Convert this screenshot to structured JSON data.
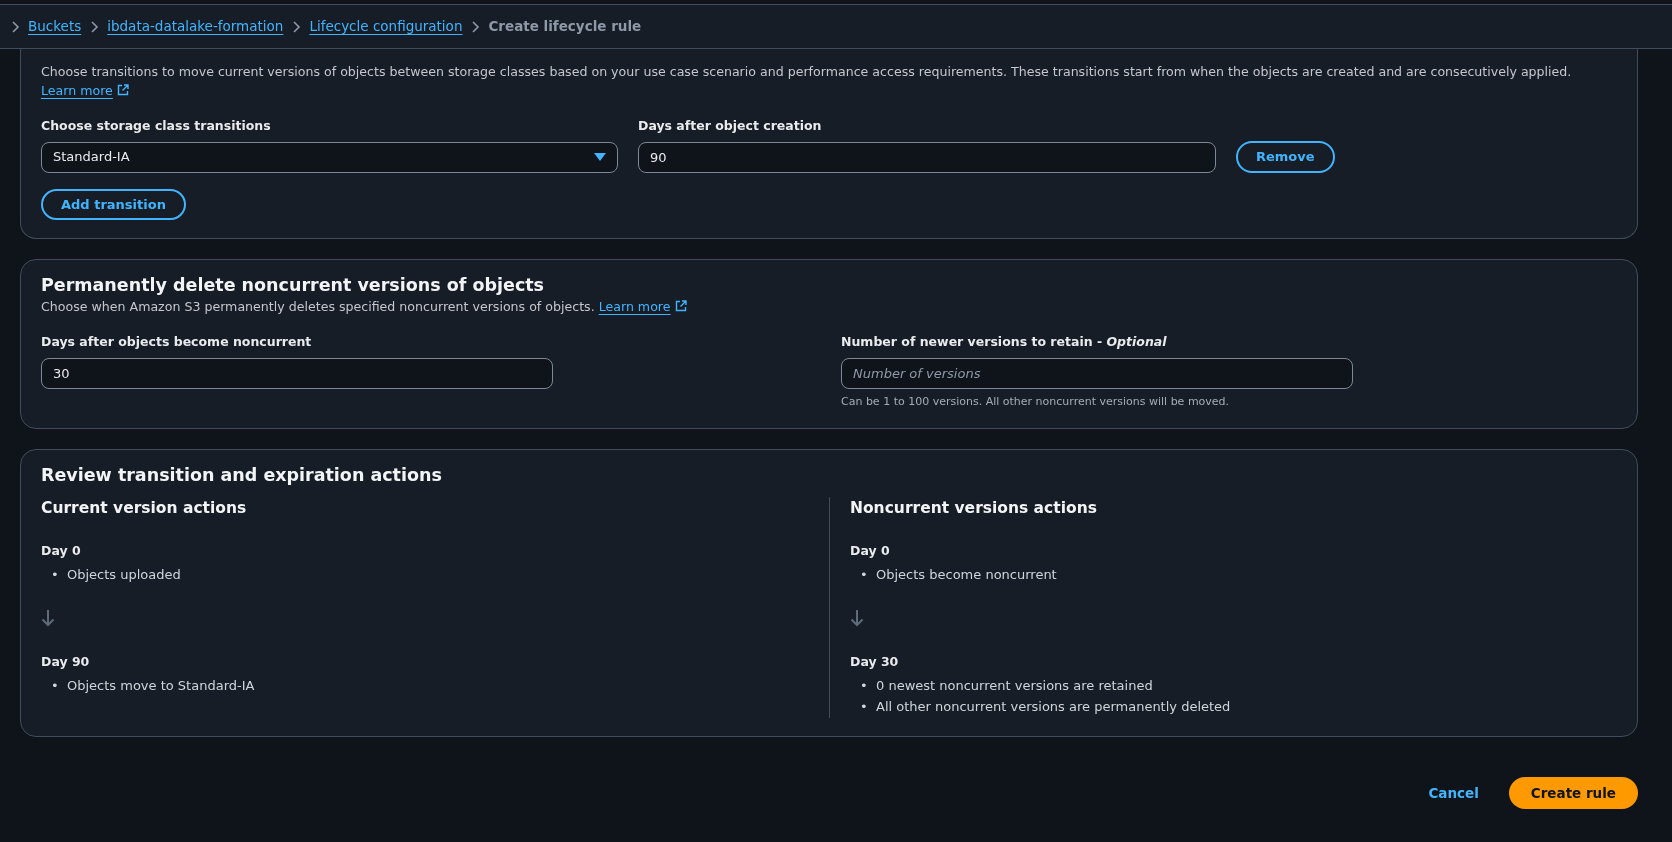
{
  "breadcrumbs": [
    {
      "label": "Buckets",
      "link": true
    },
    {
      "label": "ibdata-datalake-formation",
      "link": true
    },
    {
      "label": "Lifecycle configuration",
      "link": true
    },
    {
      "label": "Create lifecycle rule",
      "link": false
    }
  ],
  "transitions": {
    "description": "Choose transitions to move current versions of objects between storage classes based on your use case scenario and performance access requirements. These transitions start from when the objects are created and are consecutively applied.",
    "learn_more": "Learn more",
    "class_label": "Choose storage class transitions",
    "class_value": "Standard-IA",
    "days_label": "Days after object creation",
    "days_value": "90",
    "remove_button": "Remove",
    "add_button": "Add transition"
  },
  "noncurrent": {
    "title": "Permanently delete noncurrent versions of objects",
    "description": "Choose when Amazon S3 permanently deletes specified noncurrent versions of objects.",
    "learn_more": "Learn more",
    "days_label": "Days after objects become noncurrent",
    "days_value": "30",
    "versions_label": "Number of newer versions to retain - *Optional*",
    "versions_placeholder": "Number of versions",
    "versions_hint": "Can be 1 to 100 versions. All other noncurrent versions will be moved."
  },
  "review": {
    "title": "Review transition and expiration actions",
    "bullet": "•",
    "columns": [
      {
        "title": "Current version actions",
        "steps": [
          {
            "day": "Day 0",
            "items": [
              "Objects uploaded"
            ]
          },
          {
            "day": "Day 90",
            "items": [
              "Objects move to Standard-IA"
            ]
          }
        ]
      },
      {
        "title": "Noncurrent versions actions",
        "steps": [
          {
            "day": "Day 0",
            "items": [
              "Objects become noncurrent"
            ]
          },
          {
            "day": "Day 30",
            "items": [
              "0 newest noncurrent versions are retained",
              "All other noncurrent versions are permanently deleted"
            ]
          }
        ]
      }
    ]
  },
  "footer": {
    "cancel": "Cancel",
    "submit": "Create rule"
  }
}
